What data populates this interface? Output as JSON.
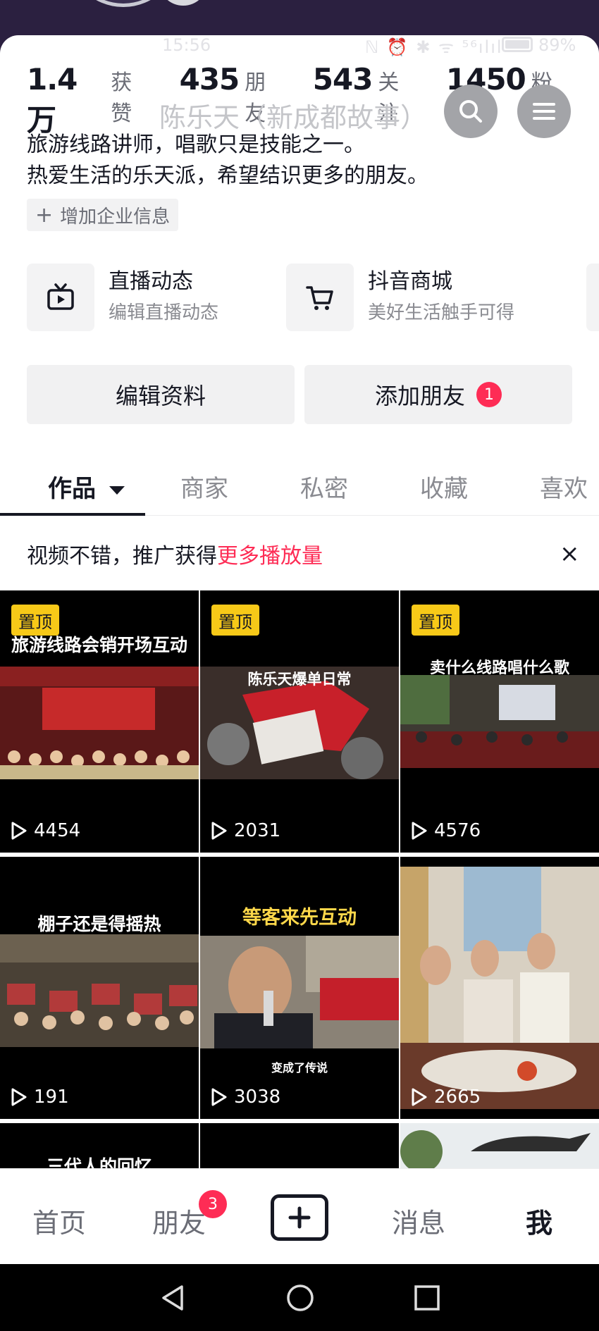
{
  "status_bar": {
    "time": "15:56",
    "icons": "ℕ ⏰ ✱ ᯤ ⁵⁶ılıl",
    "battery": "89%"
  },
  "profile": {
    "stats": [
      {
        "num": "1.4万",
        "label": "获赞"
      },
      {
        "num": "435",
        "label": "朋友"
      },
      {
        "num": "543",
        "label": "关注"
      },
      {
        "num": "1450",
        "label": "粉丝"
      }
    ],
    "floating_title": "陈乐天（新成都故事）",
    "bio_line1": "旅游线路讲师，唱歌只是技能之一。",
    "bio_line2": "热爱生活的乐天派，希望结识更多的朋友。",
    "add_business_info": "增加企业信息"
  },
  "features": [
    {
      "title": "直播动态",
      "subtitle": "编辑直播动态",
      "icon": "tv-icon"
    },
    {
      "title": "抖音商城",
      "subtitle": "美好生活触手可得",
      "icon": "cart-icon"
    }
  ],
  "actions": {
    "edit_profile": "编辑资料",
    "add_friends": "添加朋友",
    "add_friends_badge": "1"
  },
  "tabs": [
    {
      "label": "作品",
      "active": true
    },
    {
      "label": "商家"
    },
    {
      "label": "私密"
    },
    {
      "label": "收藏"
    },
    {
      "label": "喜欢"
    }
  ],
  "promo": {
    "text": "视频不错，推广获得",
    "highlight": "更多播放量",
    "close": "×"
  },
  "videos": [
    {
      "pinned": "置顶",
      "caption": "旅游线路会销开场互动",
      "plays": "4454"
    },
    {
      "pinned": "置顶",
      "caption": "陈乐天爆单日常",
      "plays": "2031"
    },
    {
      "pinned": "置顶",
      "caption": "卖什么线路唱什么歌",
      "plays": "4576"
    },
    {
      "caption": "棚子还是得摇热",
      "plays": "191"
    },
    {
      "caption": "等客来先互动",
      "subcaption": "变成了传说",
      "plays": "3038"
    },
    {
      "caption": "",
      "plays": "2665"
    },
    {
      "caption": "三代人的回忆"
    }
  ],
  "bottom_nav": {
    "home": "首页",
    "friends": "朋友",
    "friends_badge": "3",
    "messages": "消息",
    "me": "我"
  },
  "colors": {
    "accent": "#fe2c55",
    "pin": "#f7c918",
    "banner": "#2b2040"
  }
}
